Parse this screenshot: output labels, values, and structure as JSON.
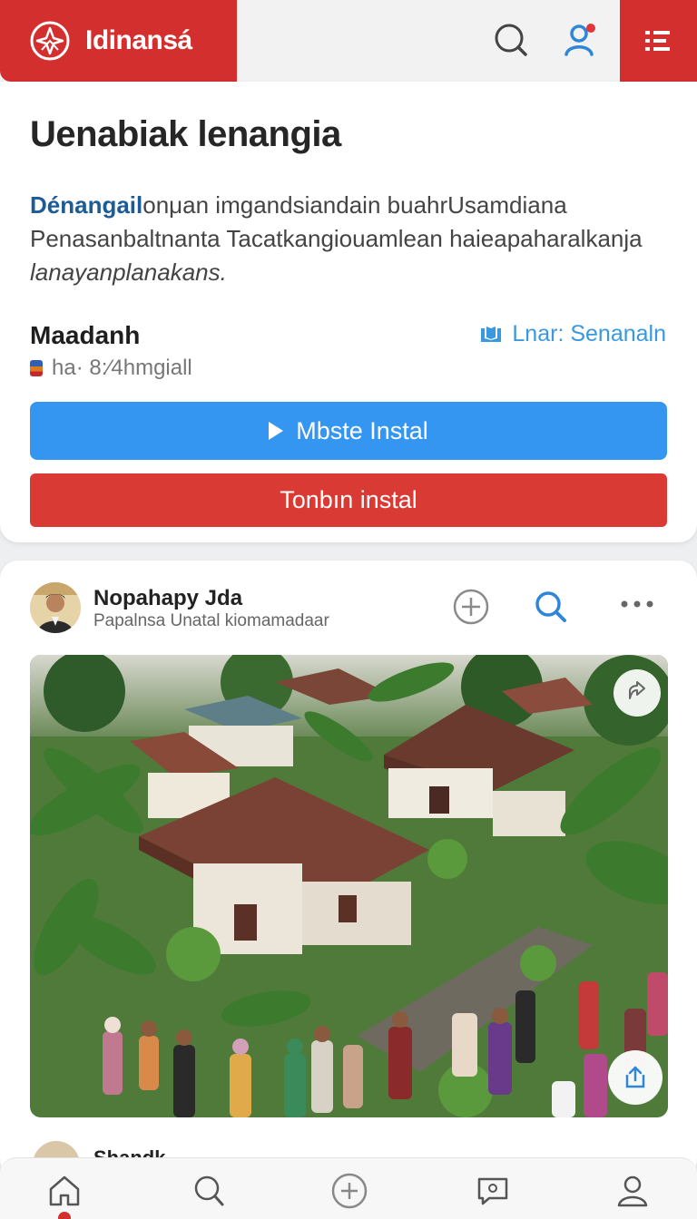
{
  "header": {
    "brand_name": "Idinansá",
    "brand_color": "#d42f2f"
  },
  "info_card": {
    "title": "Uenabiak lenangia",
    "description_highlight": "Dénangail",
    "description_line1_rest": "onμan imgandsiandain buahrUsamdiana",
    "description_line2": "Penasanbaltnanta Tacatkangiouamlean haieapaharalkanja",
    "description_line3": "lanayanplanakans.",
    "meta_label": "Maadanh",
    "meta_link": "Lnar: Senanaln",
    "meta_sub": "ha· 8:⁄4hmgiall",
    "primary_button": "Mbste Instal",
    "secondary_button": "Tonbın instal",
    "accent_blue": "#3596f2",
    "accent_red": "#d93a34"
  },
  "post": {
    "author": "Nopahapy Jda",
    "subtitle": "Papalnsa Unatal kiomamadaar",
    "next_author": "Shandk"
  },
  "icons": {
    "brand": "compass-star-logo-icon",
    "header_search": "search-icon",
    "header_user": "user-notification-icon",
    "header_menu": "menu-list-icon",
    "post_add": "plus-circle-icon",
    "post_search": "search-icon",
    "post_more": "more-dots-icon",
    "photo_share": "share-icon",
    "photo_export": "export-icon",
    "nav": [
      "home-icon",
      "search-icon",
      "add-icon",
      "chat-icon",
      "profile-icon"
    ]
  }
}
